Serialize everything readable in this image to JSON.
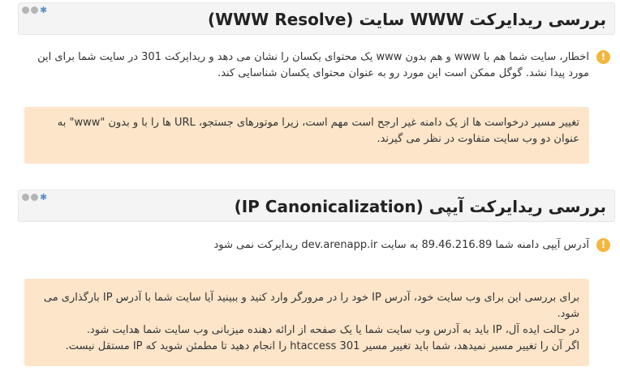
{
  "sections": [
    {
      "title": "بررسی ریدایرکت WWW سایت (WWW Resolve)",
      "warning": "اخطار، سایت شما هم با www و هم بدون www یک محتوای یکسان را نشان می دهد و ریدایرکت 301 در سایت شما برای این مورد پیدا نشد. گوگل ممکن است این مورد رو به عنوان محتوای یکسان شناسایی کند.",
      "note_lines": [
        "تغییر مسیر درخواست ها از یک دامنه غیر ارجح است مهم است، زیرا موتورهای جستجو، URL ها را با و بدون \"www\" به عنوان دو وب سایت متفاوت در نظر می گیرند."
      ]
    },
    {
      "title": "بررسی ریدایرکت آیپی (IP Canonicalization)",
      "warning": "آدرس آیپی دامنه شما 89.46.216.89 به سایت dev.arenapp.ir ریدایرکت نمی شود",
      "note_lines": [
        "برای بررسی این برای وب سایت خود، آدرس IP خود را در مرورگر وارد کنید و ببینید آیا سایت شما با آدرس IP بارگذاری می شود.",
        "در حالت ایده آل، IP باید به آدرس وب سایت شما یا یک صفحه از ارائه دهنده میزبانی وب سایت شما هدایت شود.",
        "اگر آن را تغییر مسیر نمیدهد، شما باید تغییر مسیر 301 htaccess را انجام دهید تا مطمئن شوید که IP مستقل نیست."
      ]
    }
  ],
  "colors": {
    "note_bg": "#fde5c9",
    "warning_icon": "#f4b63c",
    "header_bg": "#f4f4f4",
    "gear": "#5b8fc9"
  },
  "icons": [
    "circle-icon",
    "circle-icon",
    "gear-icon",
    "warning-icon"
  ]
}
